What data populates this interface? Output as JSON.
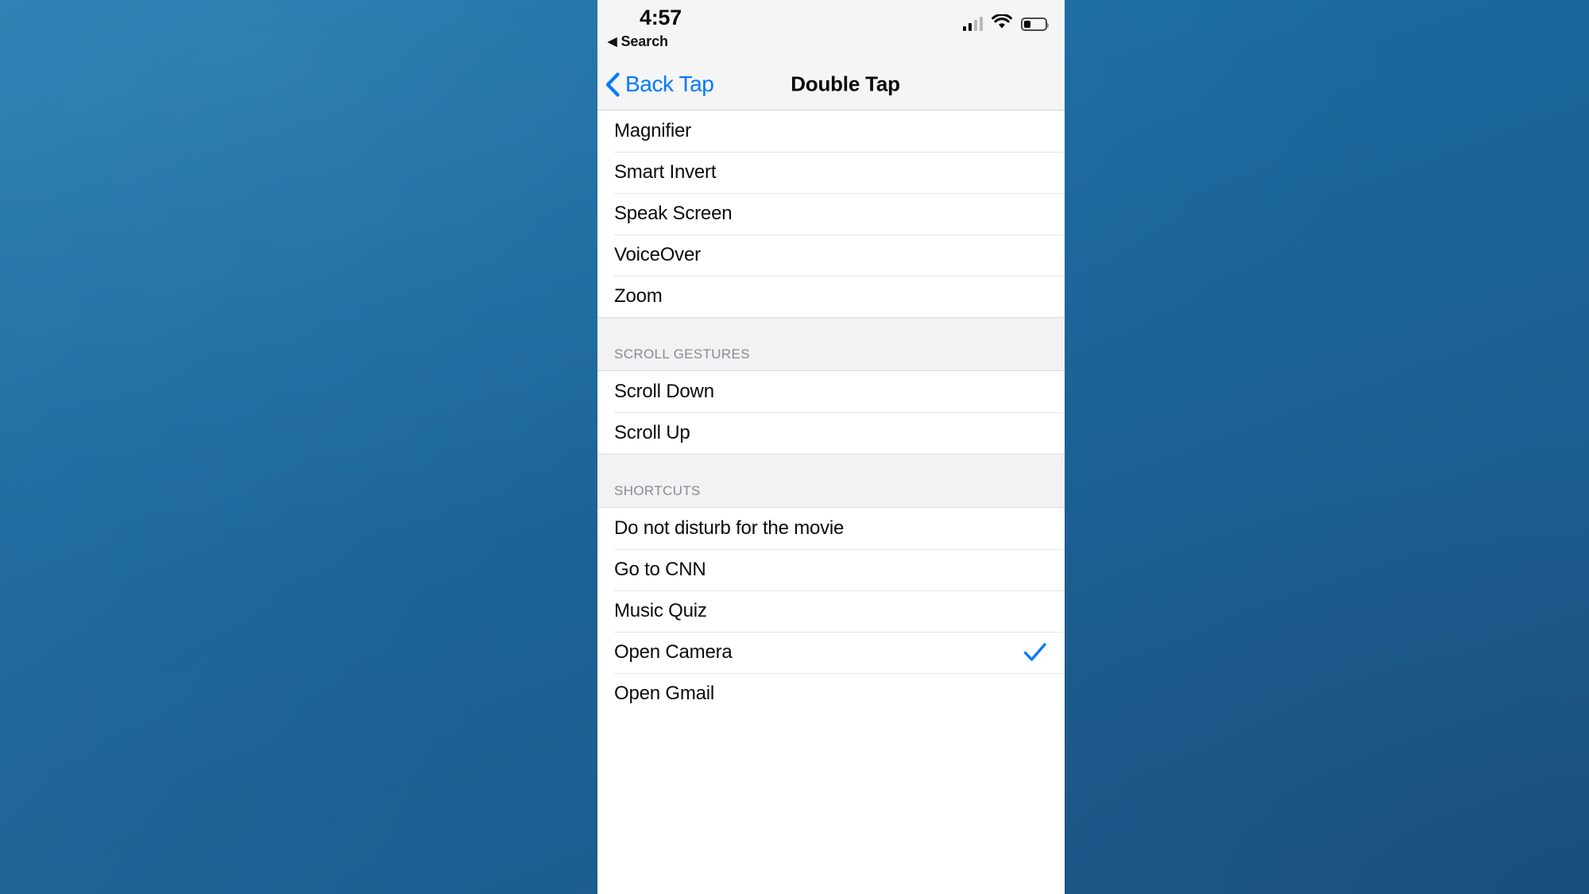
{
  "theme": {
    "accent_blue": "#007AFF",
    "desktop_blue_top": "#1D78B0",
    "desktop_blue_bottom": "#1D5689",
    "panel_background": "#FFFFFF",
    "bar_background": "#F5F5F6",
    "section_background": "#F2F2F5",
    "section_text": "#8A8A8E",
    "separator": "#E4E4E6"
  },
  "status_bar": {
    "time": "4:57",
    "return_label": "Search",
    "return_arrow": "◀",
    "icons": {
      "cellular": "cellular-bars-icon",
      "wifi": "wifi-icon",
      "battery": "battery-low-icon"
    }
  },
  "nav_bar": {
    "back_label": "Back Tap",
    "back_icon": "chevron-left-icon",
    "title": "Double Tap"
  },
  "sections": [
    {
      "id": "accessibility-features",
      "header": null,
      "rows": [
        {
          "label": "Magnifier",
          "selected": false
        },
        {
          "label": "Smart Invert",
          "selected": false
        },
        {
          "label": "Speak Screen",
          "selected": false
        },
        {
          "label": "VoiceOver",
          "selected": false
        },
        {
          "label": "Zoom",
          "selected": false
        }
      ]
    },
    {
      "id": "scroll-gestures",
      "header": "SCROLL GESTURES",
      "rows": [
        {
          "label": "Scroll Down",
          "selected": false
        },
        {
          "label": "Scroll Up",
          "selected": false
        }
      ]
    },
    {
      "id": "shortcuts",
      "header": "SHORTCUTS",
      "rows": [
        {
          "label": "Do not disturb for the movie",
          "selected": false
        },
        {
          "label": "Go to CNN",
          "selected": false
        },
        {
          "label": "Music Quiz",
          "selected": false
        },
        {
          "label": "Open Camera",
          "selected": true
        },
        {
          "label": "Open Gmail",
          "selected": false
        }
      ]
    }
  ],
  "checkmark_icon": "checkmark-icon"
}
